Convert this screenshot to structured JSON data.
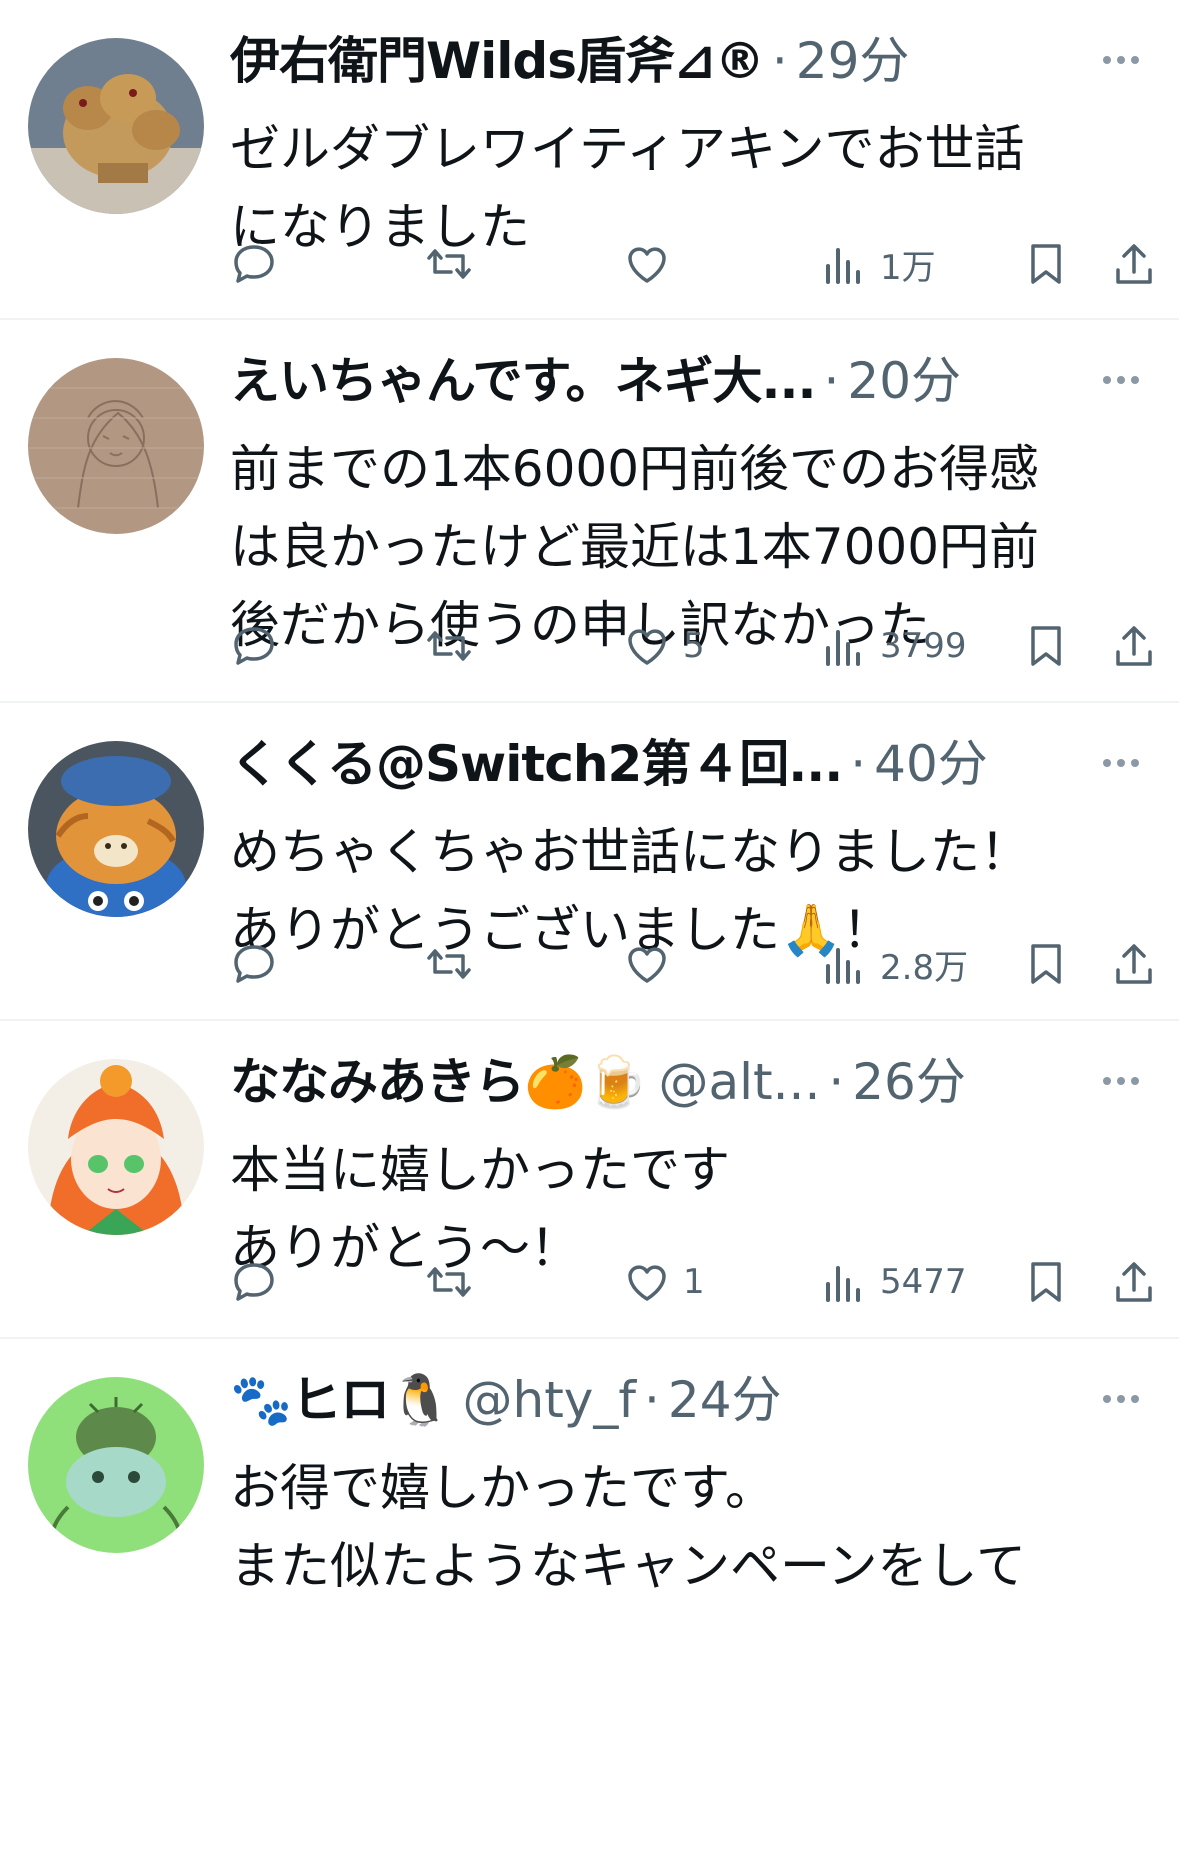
{
  "tweets": [
    {
      "name": "伊右衛門Wilds盾斧⊿®",
      "handle": "",
      "sep": "·",
      "time": "29分",
      "lines": [
        "ゼルダブレワイティアキンでお世話",
        "になりました"
      ],
      "likes": "",
      "views": "1万"
    },
    {
      "name": "えいちゃんです。ネギ大...",
      "handle": "",
      "sep": "·",
      "time": "20分",
      "lines": [
        "前までの1本6000円前後でのお得感",
        "は良かったけど最近は1本7000円前",
        "後だから使うの申し訳なかった"
      ],
      "likes": "5",
      "views": "3799"
    },
    {
      "name": "くくる@Switch2第４回...",
      "handle": "",
      "sep": "·",
      "time": "40分",
      "lines": [
        "めちゃくちゃお世話になりました！",
        "ありがとうございました🙏！"
      ],
      "likes": "",
      "views": "2.8万"
    },
    {
      "name": "ななみあきら🍊🍺",
      "handle": "@alt...",
      "sep": "·",
      "time": "26分",
      "lines": [
        "本当に嬉しかったです",
        "ありがとう〜！"
      ],
      "likes": "1",
      "views": "5477"
    },
    {
      "name": "🐾ヒロ🐧",
      "handle": "@hty_f",
      "sep": "·",
      "time": "24分",
      "lines": [
        "お得で嬉しかったです。",
        "また似たようなキャンペーンをして"
      ],
      "likes": "",
      "views": ""
    }
  ],
  "icons": {
    "reply": "reply-icon",
    "retweet": "retweet-icon",
    "like": "heart-icon",
    "views": "views-icon",
    "bookmark": "bookmark-icon",
    "share": "share-icon",
    "more": "more-icon"
  },
  "colors": {
    "text": "#0f1419",
    "secondary": "#536471",
    "divider": "#eff3f4"
  }
}
